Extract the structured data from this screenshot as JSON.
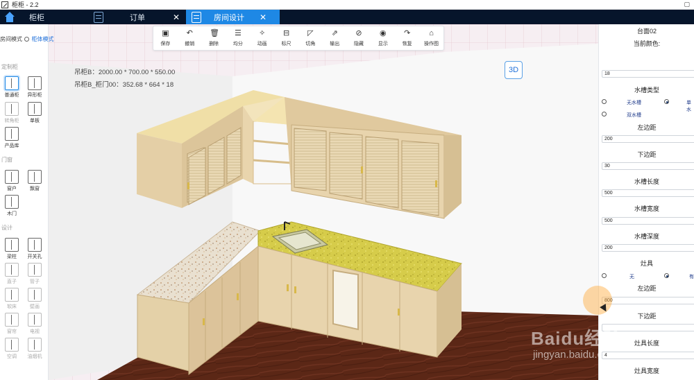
{
  "window": {
    "title": "柜柜 - 2.2",
    "restore_icon": "restore-icon"
  },
  "tabs": [
    {
      "label": "柜柜",
      "icon": "home-icon",
      "active": false
    },
    {
      "label": "订单",
      "icon": "cabinet-icon",
      "active": false
    },
    {
      "label": "房间设计",
      "icon": "cabinet-icon",
      "active": true
    }
  ],
  "tab_close": "✕",
  "left_panel": {
    "mode_room": "房间模式",
    "mode_cabinet": "柜体模式",
    "sections": {
      "custom": "定制柜",
      "doors": "门窗",
      "settings": "设计"
    },
    "items_custom": [
      {
        "label": "普通柜",
        "selected": true
      },
      {
        "label": "异形柜",
        "selected": false
      },
      {
        "label": "转角柜",
        "dim": true
      },
      {
        "label": "单板",
        "dim": false
      },
      {
        "label": "产品库",
        "dim": false
      }
    ],
    "items_doors": [
      {
        "label": "窗户"
      },
      {
        "label": "飘窗"
      },
      {
        "label": "木门"
      }
    ],
    "items_settings": [
      {
        "label": "梁柱",
        "dim": false
      },
      {
        "label": "开关孔",
        "dim": false
      },
      {
        "label": "直子",
        "dim": true
      },
      {
        "label": "管子",
        "dim": true
      },
      {
        "label": "软床",
        "dim": true
      },
      {
        "label": "壁画",
        "dim": true
      },
      {
        "label": "窗帘",
        "dim": true
      },
      {
        "label": "电视",
        "dim": true
      },
      {
        "label": "空调",
        "dim": true
      },
      {
        "label": "油烟机",
        "dim": true
      }
    ]
  },
  "toolbar": [
    {
      "label": "保存",
      "icon": "save-icon"
    },
    {
      "label": "撤销",
      "icon": "undo-icon"
    },
    {
      "label": "删除",
      "icon": "delete-icon"
    },
    {
      "label": "均分",
      "icon": "distribute-icon"
    },
    {
      "label": "动画",
      "icon": "animation-icon"
    },
    {
      "label": "标尺",
      "icon": "ruler-icon"
    },
    {
      "label": "切角",
      "icon": "chamfer-icon"
    },
    {
      "label": "输出",
      "icon": "export-icon"
    },
    {
      "label": "隐藏",
      "icon": "hide-icon"
    },
    {
      "label": "显示",
      "icon": "show-icon"
    },
    {
      "label": "恢复",
      "icon": "redo-icon"
    },
    {
      "label": "操作图",
      "icon": "operation-icon"
    }
  ],
  "info": {
    "line1": "吊柜B：2000.00 * 700.00 * 550.00",
    "line2": "吊柜B_柜门00：352.68 * 664 * 18"
  },
  "view_button": "3D",
  "properties": {
    "header": "台面02",
    "current_color": "当前颜色:",
    "thickness_value": "18",
    "sink_type_label": "水槽类型",
    "sink_options": [
      "无水槽",
      "单水",
      "双水槽"
    ],
    "sink_selected": "单水",
    "left_margin_label": "左边距",
    "left_margin_value": "200",
    "bottom_margin_label": "下边距",
    "bottom_margin_value": "30",
    "sink_length_label": "水槽长度",
    "sink_length_value": "500",
    "sink_width_label": "水槽宽度",
    "sink_width_value": "500",
    "sink_depth_label": "水槽深度",
    "sink_depth_value": "200",
    "stove_label": "灶具",
    "stove_options": [
      "无",
      "有"
    ],
    "stove_selected": "有",
    "stove_left_label": "左边距",
    "stove_left_value": "800",
    "stove_bottom_label": "下边距",
    "stove_length_label": "灶具长度",
    "stove_length_value": "4",
    "stove_width_label": "灶具宽度"
  },
  "watermark": {
    "main": "Baidu经验",
    "sub": "jingyan.baidu.com"
  },
  "colors": {
    "tabbar_bg": "#06152b",
    "tab_active": "#1e88e5",
    "accent": "#1e6fd9",
    "floor": "#5a2a1a",
    "cabinet": "#e8d4ad",
    "wall": "#ececec"
  }
}
